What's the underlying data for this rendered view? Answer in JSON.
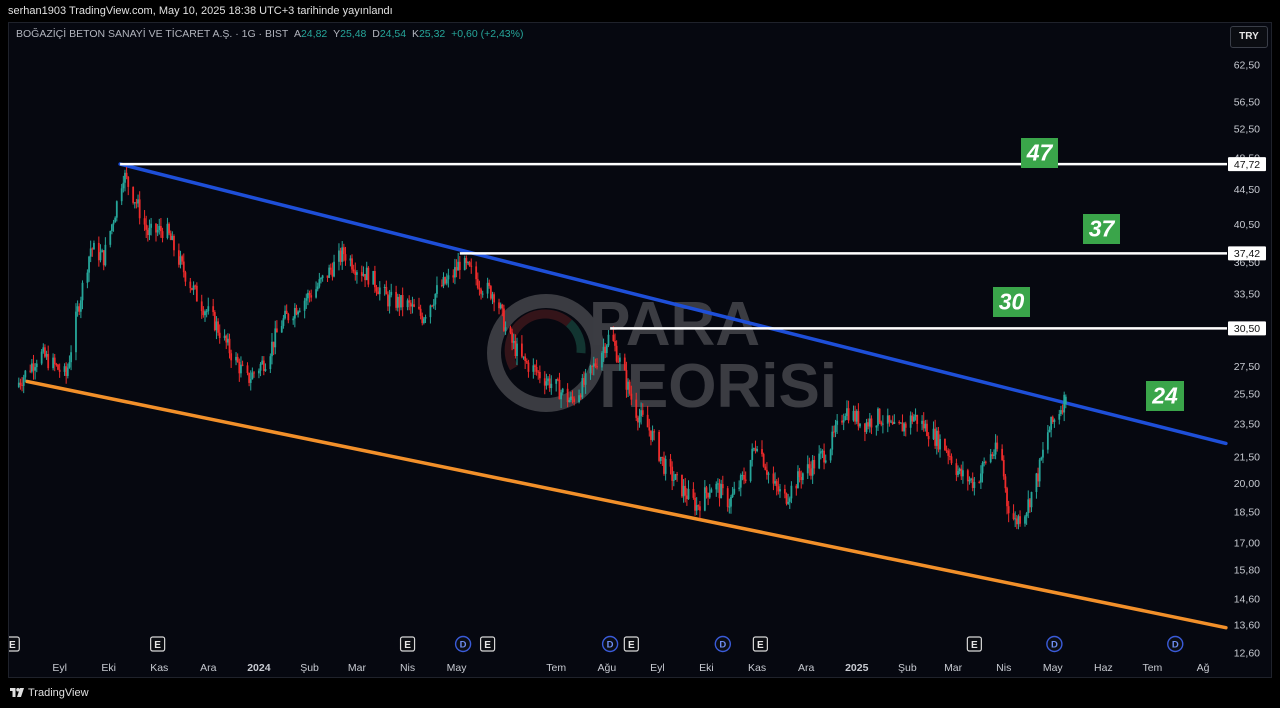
{
  "header": {
    "publisher": "serhan1903 TradingView.com, May 10, 2025 18:38 UTC+3 tarihinde yayınlandı"
  },
  "legend": {
    "symbol": "BOĞAZİÇİ BETON SANAYİ VE TİCARET A.Ş. · 1G · BIST",
    "open_label": "A",
    "open": "24,82",
    "high_label": "Y",
    "high": "25,48",
    "low_label": "D",
    "low": "24,54",
    "close_label": "K",
    "close": "25,32",
    "change": "+0,60 (+2,43%)"
  },
  "currency": "TRY",
  "footer": {
    "brand": "TradingView"
  },
  "watermark": {
    "line1": "PARA",
    "line2": "TEORiSi"
  },
  "colors": {
    "up": "#26a69a",
    "down": "#ef2b2b",
    "resistance": "#1e4fd8",
    "support": "#f2902a",
    "level": "#ffffff",
    "label_bg": "#3aa54a"
  },
  "chart_data": {
    "type": "candlestick",
    "title": "",
    "xlabel": "",
    "ylabel": "",
    "y_scale": "log",
    "ylim": [
      12.6,
      66
    ],
    "y_ticks": [
      "62,50",
      "56,50",
      "52,50",
      "48,50",
      "44,50",
      "40,50",
      "36,50",
      "33,50",
      "30,50",
      "27,50",
      "25,50",
      "23,50",
      "21,50",
      "20,00",
      "18,50",
      "17,00",
      "15,80",
      "14,60",
      "13,60",
      "12,60"
    ],
    "x_ticks": [
      {
        "label": "Eyl",
        "date": "2023-09-01"
      },
      {
        "label": "Eki",
        "date": "2023-10-01"
      },
      {
        "label": "Kas",
        "date": "2023-11-01"
      },
      {
        "label": "Ara",
        "date": "2023-12-01"
      },
      {
        "label": "2024",
        "date": "2024-01-01",
        "bold": true
      },
      {
        "label": "Şub",
        "date": "2024-02-01"
      },
      {
        "label": "Mar",
        "date": "2024-03-01"
      },
      {
        "label": "Nis",
        "date": "2024-04-01"
      },
      {
        "label": "May",
        "date": "2024-05-01"
      },
      {
        "label": "Tem",
        "date": "2024-07-01"
      },
      {
        "label": "Ağu",
        "date": "2024-08-01"
      },
      {
        "label": "Eyl",
        "date": "2024-09-01"
      },
      {
        "label": "Eki",
        "date": "2024-10-01"
      },
      {
        "label": "Kas",
        "date": "2024-11-01"
      },
      {
        "label": "Ara",
        "date": "2024-12-01"
      },
      {
        "label": "2025",
        "date": "2025-01-01",
        "bold": true
      },
      {
        "label": "Şub",
        "date": "2025-02-01"
      },
      {
        "label": "Mar",
        "date": "2025-03-01"
      },
      {
        "label": "Nis",
        "date": "2025-04-01"
      },
      {
        "label": "May",
        "date": "2025-05-01"
      },
      {
        "label": "Haz",
        "date": "2025-06-01"
      },
      {
        "label": "Tem",
        "date": "2025-07-01"
      },
      {
        "label": "Ağ",
        "date": "2025-08-01"
      }
    ],
    "price_path": [
      {
        "date": "2023-08-05",
        "close": 26.0
      },
      {
        "date": "2023-08-20",
        "close": 28.5
      },
      {
        "date": "2023-09-05",
        "close": 26.8
      },
      {
        "date": "2023-09-12",
        "close": 32.0
      },
      {
        "date": "2023-09-20",
        "close": 38.0
      },
      {
        "date": "2023-09-28",
        "close": 37.0
      },
      {
        "date": "2023-10-05",
        "close": 42.0
      },
      {
        "date": "2023-10-10",
        "close": 46.5
      },
      {
        "date": "2023-10-18",
        "close": 43.0
      },
      {
        "date": "2023-10-25",
        "close": 39.5
      },
      {
        "date": "2023-11-05",
        "close": 40.0
      },
      {
        "date": "2023-11-15",
        "close": 36.0
      },
      {
        "date": "2023-11-25",
        "close": 33.0
      },
      {
        "date": "2023-12-05",
        "close": 31.0
      },
      {
        "date": "2023-12-15",
        "close": 28.5
      },
      {
        "date": "2023-12-25",
        "close": 26.5
      },
      {
        "date": "2024-01-05",
        "close": 28.0
      },
      {
        "date": "2024-01-15",
        "close": 31.0
      },
      {
        "date": "2024-01-25",
        "close": 32.5
      },
      {
        "date": "2024-02-05",
        "close": 34.0
      },
      {
        "date": "2024-02-15",
        "close": 36.0
      },
      {
        "date": "2024-02-22",
        "close": 37.5
      },
      {
        "date": "2024-03-01",
        "close": 36.0
      },
      {
        "date": "2024-03-10",
        "close": 35.0
      },
      {
        "date": "2024-03-20",
        "close": 33.0
      },
      {
        "date": "2024-04-01",
        "close": 32.5
      },
      {
        "date": "2024-04-10",
        "close": 31.5
      },
      {
        "date": "2024-04-20",
        "close": 34.0
      },
      {
        "date": "2024-04-28",
        "close": 35.0
      },
      {
        "date": "2024-05-03",
        "close": 36.5
      },
      {
        "date": "2024-05-10",
        "close": 35.5
      },
      {
        "date": "2024-05-18",
        "close": 34.0
      },
      {
        "date": "2024-05-25",
        "close": 33.5
      },
      {
        "date": "2024-06-01",
        "close": 30.0
      },
      {
        "date": "2024-06-10",
        "close": 28.0
      },
      {
        "date": "2024-06-20",
        "close": 27.0
      },
      {
        "date": "2024-07-01",
        "close": 26.0
      },
      {
        "date": "2024-07-10",
        "close": 25.0
      },
      {
        "date": "2024-07-20",
        "close": 26.5
      },
      {
        "date": "2024-07-28",
        "close": 28.5
      },
      {
        "date": "2024-08-03",
        "close": 30.0
      },
      {
        "date": "2024-08-10",
        "close": 27.5
      },
      {
        "date": "2024-08-18",
        "close": 24.5
      },
      {
        "date": "2024-08-28",
        "close": 23.0
      },
      {
        "date": "2024-09-05",
        "close": 21.0
      },
      {
        "date": "2024-09-15",
        "close": 19.8
      },
      {
        "date": "2024-09-25",
        "close": 18.8
      },
      {
        "date": "2024-10-05",
        "close": 20.0
      },
      {
        "date": "2024-10-15",
        "close": 19.0
      },
      {
        "date": "2024-10-25",
        "close": 20.5
      },
      {
        "date": "2024-11-01",
        "close": 22.5
      },
      {
        "date": "2024-11-10",
        "close": 20.0
      },
      {
        "date": "2024-11-18",
        "close": 19.2
      },
      {
        "date": "2024-11-28",
        "close": 20.5
      },
      {
        "date": "2024-12-05",
        "close": 21.0
      },
      {
        "date": "2024-12-15",
        "close": 22.0
      },
      {
        "date": "2024-12-25",
        "close": 24.5
      },
      {
        "date": "2025-01-05",
        "close": 23.5
      },
      {
        "date": "2025-01-15",
        "close": 24.0
      },
      {
        "date": "2025-01-25",
        "close": 23.0
      },
      {
        "date": "2025-02-05",
        "close": 24.0
      },
      {
        "date": "2025-02-15",
        "close": 23.0
      },
      {
        "date": "2025-02-25",
        "close": 22.0
      },
      {
        "date": "2025-03-05",
        "close": 20.5
      },
      {
        "date": "2025-03-15",
        "close": 20.0
      },
      {
        "date": "2025-03-22",
        "close": 21.5
      },
      {
        "date": "2025-03-30",
        "close": 22.0
      },
      {
        "date": "2025-04-03",
        "close": 19.0
      },
      {
        "date": "2025-04-08",
        "close": 18.0
      },
      {
        "date": "2025-04-15",
        "close": 18.7
      },
      {
        "date": "2025-04-22",
        "close": 20.5
      },
      {
        "date": "2025-04-28",
        "close": 23.0
      },
      {
        "date": "2025-05-03",
        "close": 24.0
      },
      {
        "date": "2025-05-09",
        "close": 25.32
      }
    ],
    "lines": [
      {
        "name": "resistance",
        "start": {
          "date": "2023-10-08",
          "price": 47.72
        },
        "end": {
          "date": "2025-08-15",
          "price": 22.3
        }
      },
      {
        "name": "support",
        "start": {
          "date": "2023-08-12",
          "price": 26.4
        },
        "end": {
          "date": "2025-08-15",
          "price": 13.5
        }
      }
    ],
    "levels": [
      {
        "price": 47.72,
        "axis_label": "47,72",
        "tag": "47",
        "from": "2023-10-08"
      },
      {
        "price": 37.42,
        "axis_label": "37,42",
        "tag": "37",
        "from": "2024-05-03"
      },
      {
        "price": 30.5,
        "axis_label": "30,50",
        "tag": "30",
        "from": "2024-08-03"
      }
    ],
    "tags": [
      {
        "text": "24",
        "date": "2025-06-12",
        "price": 25.2
      }
    ],
    "event_markers": [
      {
        "type": "E",
        "date": "2023-08-03"
      },
      {
        "type": "E",
        "date": "2023-10-31"
      },
      {
        "type": "E",
        "date": "2024-04-01"
      },
      {
        "type": "D",
        "date": "2024-05-05"
      },
      {
        "type": "E",
        "date": "2024-05-20"
      },
      {
        "type": "D",
        "date": "2024-08-03"
      },
      {
        "type": "E",
        "date": "2024-08-16"
      },
      {
        "type": "D",
        "date": "2024-10-11"
      },
      {
        "type": "E",
        "date": "2024-11-03"
      },
      {
        "type": "E",
        "date": "2025-03-14"
      },
      {
        "type": "D",
        "date": "2025-05-02"
      },
      {
        "type": "D",
        "date": "2025-07-15"
      }
    ]
  }
}
